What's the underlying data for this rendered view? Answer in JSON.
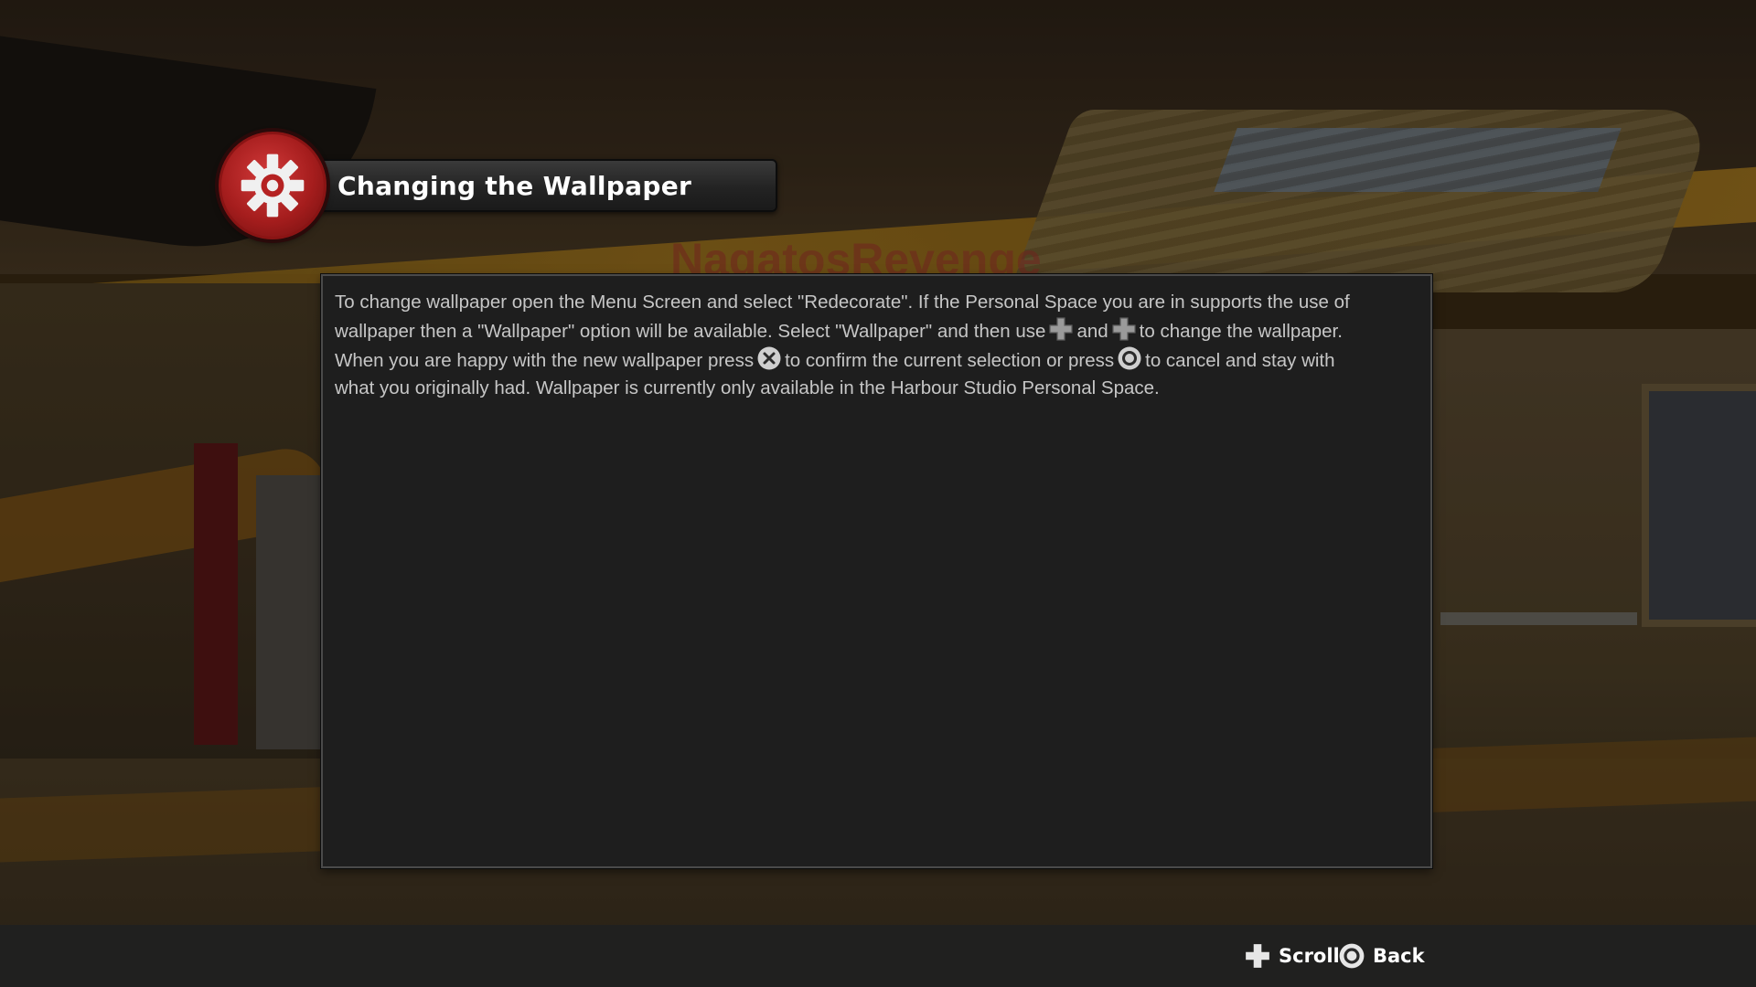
{
  "background": {
    "watermark_text": "NagatosRevenge"
  },
  "header": {
    "title": "Changing the Wallpaper",
    "icon": "gear-icon",
    "badge_color": "#b52222"
  },
  "help_panel": {
    "text_segments": {
      "s1": "To change wallpaper open the Menu Screen and select \"Redecorate\".  If the Personal Space you are in supports the use of wallpaper then a \"Wallpaper\" option will be available. Select \"Wallpaper\" and then use",
      "s2": "and",
      "s3": "to change the wallpaper.  When you are happy with the new wallpaper press",
      "s4": "to confirm the current selection or press",
      "s5": "to cancel and stay with what you originally had.  Wallpaper is currently only available in the Harbour Studio Personal Space."
    },
    "inline_icons": [
      "dpad-icon",
      "dpad-icon",
      "cross-button-icon",
      "circle-button-icon"
    ]
  },
  "footer": {
    "hints": [
      {
        "icon": "dpad-icon",
        "label": "Scroll"
      },
      {
        "icon": "circle-button-icon",
        "label": "Back"
      }
    ]
  },
  "colors": {
    "panel_bg": "#1e1e1e",
    "panel_text": "#c6c6c6",
    "hint_text": "#ffffff"
  }
}
